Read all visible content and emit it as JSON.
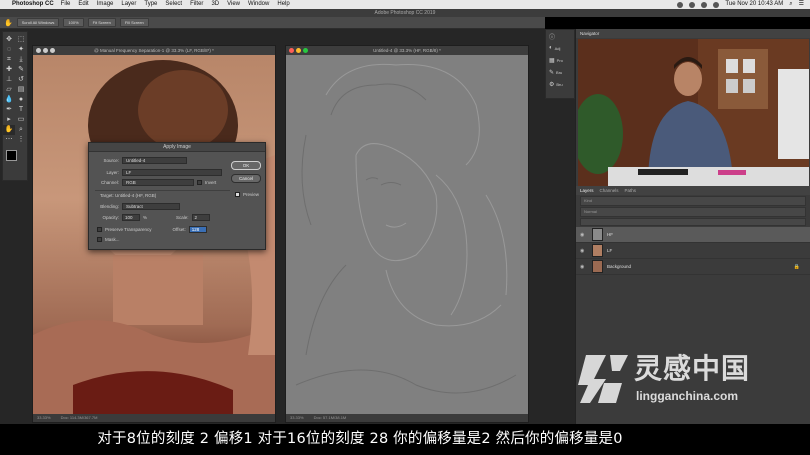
{
  "menubar": {
    "app": "Photoshop CC",
    "items": [
      "File",
      "Edit",
      "Image",
      "Layer",
      "Type",
      "Select",
      "Filter",
      "3D",
      "View",
      "Window",
      "Help"
    ],
    "clock": "Tue Nov 20  10:43 AM"
  },
  "app_title": "Adobe Photoshop CC 2019",
  "options_bar": {
    "buttons": [
      "Scroll All Windows",
      "100%",
      "Fit Screen",
      "Fill Screen"
    ]
  },
  "doc1": {
    "title": "@ Manual Frequency Separation-1 @ 33.3% (LF, RGB/8*) *",
    "zoom": "33.33%",
    "doc_size": "Doc: 114.3M/367.7M"
  },
  "doc2": {
    "title": "Untitled-4 @ 33.3% (HF, RGB/8) *",
    "zoom": "33.33%",
    "doc_size": "Doc: 57.1M/38.1M"
  },
  "dialog": {
    "title": "Apply Image",
    "source_label": "Source:",
    "source_value": "Untitled-4",
    "layer_label": "Layer:",
    "layer_value": "LF",
    "channel_label": "Channel:",
    "channel_value": "RGB",
    "invert_label": "Invert",
    "target_text": "Target:  Untitled-4 (HF, RGB)",
    "blending_label": "Blending:",
    "blending_value": "Subtract",
    "opacity_label": "Opacity:",
    "opacity_value": "100",
    "opacity_unit": "%",
    "scale_label": "Scale:",
    "scale_value": "2",
    "preserve_label": "Preserve Transparency",
    "offset_label": "Offset:",
    "offset_value": "128",
    "mask_label": "Mask...",
    "ok_label": "OK",
    "cancel_label": "Cancel",
    "preview_label": "Preview",
    "preview_checked": true
  },
  "panel_strip": [
    "Adj",
    "Pro",
    "Bru",
    "Bru"
  ],
  "navigator": {
    "tab": "Navigator"
  },
  "layers_panel": {
    "tabs": [
      "Layers",
      "Channels",
      "Paths"
    ],
    "kind_label": "Kind",
    "mode_label": "Normal",
    "layers": [
      {
        "name": "HF",
        "selected": true,
        "thumb_color": "#8a8a8a"
      },
      {
        "name": "LF",
        "selected": false,
        "thumb_color": "#b07e62"
      },
      {
        "name": "Background",
        "selected": false,
        "thumb_color": "#9b6a52"
      }
    ]
  },
  "subtitle": "对于8位的刻度 2 偏移1 对于16位的刻度 28 你的偏移量是2 然后你的偏移量是0",
  "watermark": {
    "chinese": "灵感中国",
    "url": "lingganchina.com"
  }
}
